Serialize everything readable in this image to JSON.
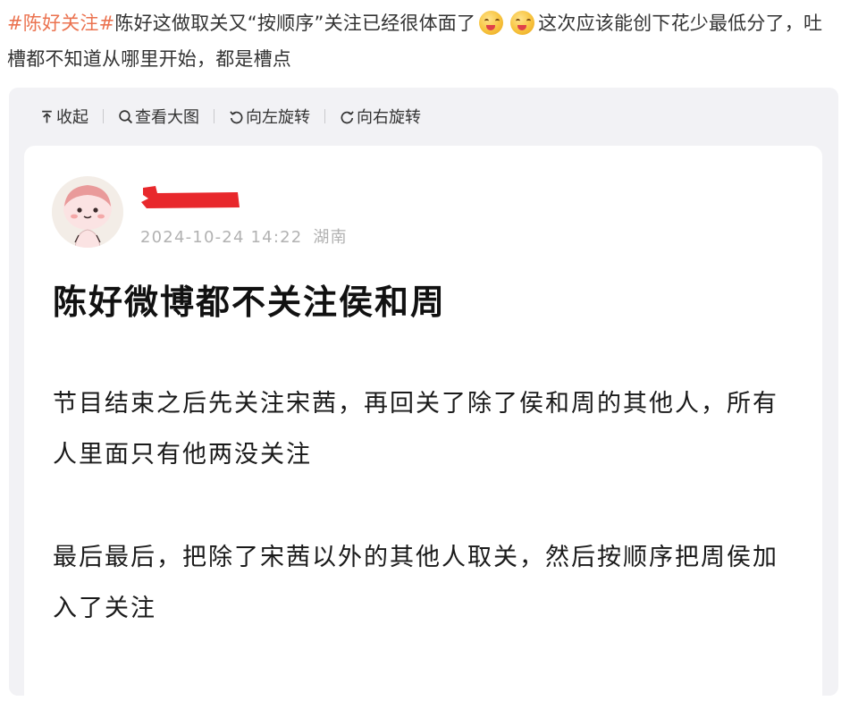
{
  "post": {
    "hashtag": "#陈好关注#",
    "text_before_emoji": "陈好这做取关又“按顺序”关注已经很体面了",
    "emoji_icon": "savoring-food-face-emoji",
    "text_after_emoji": "这次应该能创下花少最低分了，吐槽都不知道从哪里开始，都是槽点"
  },
  "toolbar": {
    "collapse_label": "收起",
    "view_large_label": "查看大图",
    "rotate_left_label": "向左旋转",
    "rotate_right_label": "向右旋转"
  },
  "card": {
    "date": "2024-10-24 14:22",
    "location": "湖南",
    "title": "陈好微博都不关注侯和周",
    "paragraph_1": "节目结束之后先关注宋茜，再回关了除了侯和周的其他人，所有人里面只有他两没关注",
    "paragraph_2": "最后最后，把除了宋茜以外的其他人取关，然后按顺序把周侯加入了关注"
  },
  "colors": {
    "hashtag": "#eb7350",
    "viewer_bg": "#f2f2f5",
    "redaction": "#e8282c",
    "meta_text": "#b2b2b2"
  }
}
